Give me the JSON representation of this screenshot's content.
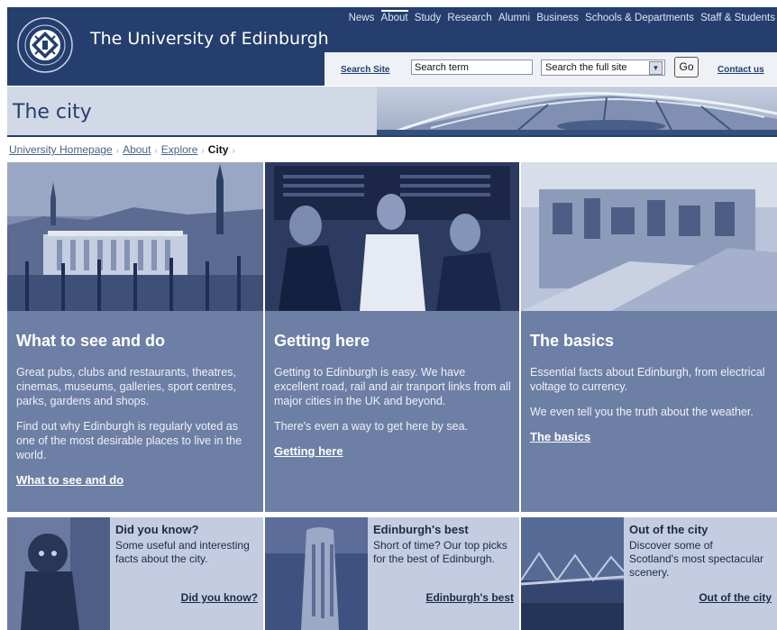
{
  "header": {
    "university_name": "The University of Edinburgh",
    "nav": [
      "News",
      "About",
      "Study",
      "Research",
      "Alumni",
      "Business",
      "Schools & Departments",
      "Staff & Students"
    ],
    "active_nav": "About",
    "search": {
      "label": "Search Site",
      "input_value": "Search term",
      "scope_selected": "Search the full site",
      "go_label": "Go",
      "contact_label": "Contact us"
    }
  },
  "banner": {
    "title": "The city"
  },
  "breadcrumb": {
    "items": [
      "University Homepage",
      "About",
      "Explore"
    ],
    "current": "City",
    "separator": "›"
  },
  "panels": [
    {
      "title": "What to see and do",
      "paragraphs": [
        "Great pubs, clubs and restaurants, theatres, cinemas, museums, galleries, sport centres, parks, gardens and shops.",
        "Find out why Edinburgh is regularly voted as one of the most desirable places to live in the world."
      ],
      "link": "What to see and do"
    },
    {
      "title": "Getting here",
      "paragraphs": [
        "Getting to Edinburgh is easy. We have excellent road, rail and air tranport links from all major cities in the UK and beyond.",
        "There's even a way to get here by sea."
      ],
      "link": "Getting here"
    },
    {
      "title": "The basics",
      "paragraphs": [
        "Essential facts about Edinburgh, from electrical voltage to currency.",
        "We even tell you the truth about the weather."
      ],
      "link": "The basics"
    }
  ],
  "tiles": [
    {
      "title": "Did you know?",
      "description": "Some useful and interesting facts about the city.",
      "link": "Did you know?"
    },
    {
      "title": "Edinburgh's best",
      "description": "Short of time? Our top picks for the best of Edinburgh.",
      "link": "Edinburgh's best"
    },
    {
      "title": "Out of the city",
      "description": "Discover some of Scotland's most spectacular scenery.",
      "link": "Out of the city"
    }
  ],
  "colors": {
    "brand_navy": "#253e6e",
    "panel_blue": "#6e7fa6",
    "tile_blue": "#c3cce0",
    "banner_bg": "#d2d9e6"
  },
  "icons": {
    "crest": "university-crest-icon",
    "dropdown": "chevron-down-icon"
  }
}
